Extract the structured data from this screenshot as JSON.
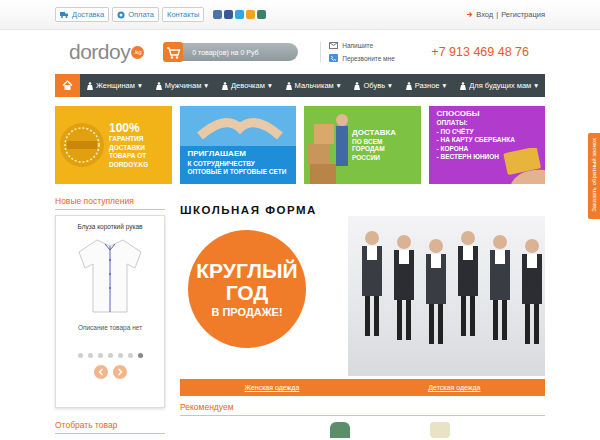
{
  "topbar": {
    "links": [
      {
        "label": "Доставка"
      },
      {
        "label": "Оплата"
      },
      {
        "label": "Контакты"
      }
    ],
    "social": [
      {
        "color": "#4c75a3"
      },
      {
        "color": "#3b5998"
      },
      {
        "color": "#2ba9e1"
      },
      {
        "color": "#f4a320"
      },
      {
        "color": "#3d7f6e"
      }
    ],
    "auth": {
      "login": "Вход",
      "separator": "|",
      "register": "Регистрация"
    }
  },
  "header": {
    "logo": {
      "text": "dordoy",
      "badge": ".kg"
    },
    "cart": {
      "label": "0 товар(ов) на 0 Руб"
    },
    "contacts": [
      "Напишите",
      "Перезвоните мне"
    ],
    "phone": "+7 913 469 48 76"
  },
  "nav": {
    "home": {
      "selected": true
    },
    "items": [
      {
        "label": "Женщинам",
        "arrow": "▾",
        "selected": false
      },
      {
        "label": "Мужчинам",
        "arrow": "▾",
        "selected": false
      },
      {
        "label": "Девочкам",
        "arrow": "▾",
        "selected": false
      },
      {
        "label": "Мальчикам",
        "arrow": "▾",
        "selected": false
      },
      {
        "label": "Обувь",
        "arrow": "▾",
        "selected": false
      },
      {
        "label": "Разное",
        "arrow": "▾",
        "selected": false
      },
      {
        "label": "Для будущих мам",
        "arrow": "▾",
        "selected": false
      }
    ]
  },
  "banners": [
    {
      "kind": "guarantee",
      "color": "#f2b319",
      "title": "100%",
      "lines": [
        "ГАРАНТИЯ",
        "ДОСТАВКИ",
        "ТОВАРА ОТ",
        "DORDOY.KG"
      ]
    },
    {
      "kind": "partner",
      "color": "#1f8ed8",
      "title": "ПРИГЛАШАЕМ",
      "lines": [
        "К СОТРУДНИЧЕСТВУ",
        "ОПТОВЫЕ И ТОРГОВЫЕ СЕТИ"
      ]
    },
    {
      "kind": "delivery",
      "color": "#7dc242",
      "title": "ДОСТАВКА",
      "lines": [
        "ПО ВСЕМ ГОРОДАМ",
        "РОССИИ"
      ]
    },
    {
      "kind": "payment",
      "color": "#b13bcc",
      "title": "СПОСОБЫ",
      "lines": [
        "ОПЛАТЫ:",
        "- ПО СЧЁТУ",
        "- НА КАРТУ СБЕРБАНКА",
        "- КОРОНА",
        "- ВЕСТЕРН ЮНИОН"
      ]
    }
  ],
  "sidebar": {
    "title": "Новые поступления",
    "product": {
      "name": "Блуза короткий рукав",
      "description": "Описание товара нет"
    },
    "dots": [
      {
        "selected": false
      },
      {
        "selected": false
      },
      {
        "selected": false
      },
      {
        "selected": false
      },
      {
        "selected": false
      },
      {
        "selected": false
      },
      {
        "selected": true
      }
    ],
    "filter_title": "Отобрать товар"
  },
  "promo": {
    "title": "ШКОЛЬНАЯ ФОРМА",
    "badge": [
      "КРУГЛЫЙ",
      "ГОД",
      "В ПРОДАЖЕ!"
    ]
  },
  "category_links": [
    "Женская одежда",
    "Детская одежда"
  ],
  "recommend": {
    "title": "Рекомендуем"
  },
  "side_tab": {
    "label": "Заказать обратный звонок"
  }
}
